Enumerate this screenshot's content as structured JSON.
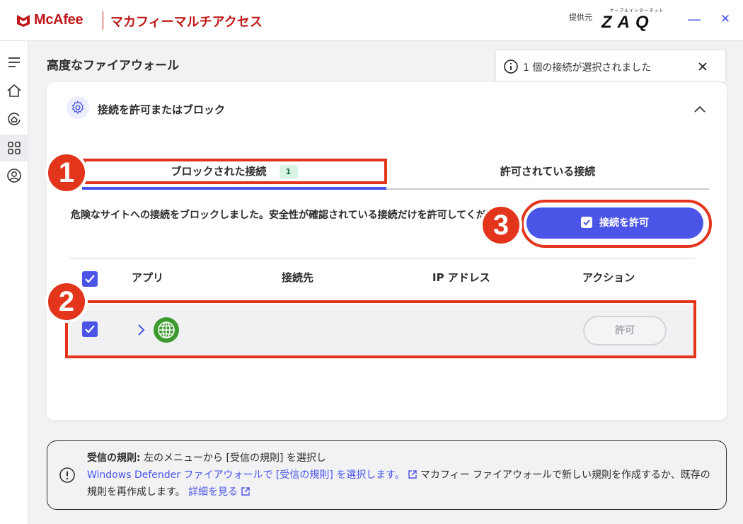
{
  "titlebar": {
    "brand": "McAfee",
    "app_title": "マカフィーマルチアクセス",
    "provider_label": "提供元",
    "provider_logo_small": "ケーブルインターネット",
    "provider_logo": "ZAQ",
    "minimize_glyph": "—",
    "close_glyph": "✕"
  },
  "nav": {
    "items": [
      "menu-icon",
      "home-icon",
      "protection-icon",
      "apps-icon",
      "account-icon"
    ],
    "active_index": 3
  },
  "page": {
    "title": "高度なファイアウォール"
  },
  "toast": {
    "text": "1 個の接続が選択されました"
  },
  "card": {
    "section_title": "接続を許可またはブロック",
    "tabs": {
      "blocked_label": "ブロックされた接続",
      "blocked_count": "1",
      "allowed_label": "許可されている接続"
    },
    "description": "危険なサイトへの接続をブロックしました。安全性が確認されている接続だけを許可してください。",
    "allow_button": "接続を許可",
    "columns": {
      "app": "アプリ",
      "destination": "接続先",
      "ip": "IP アドレス",
      "action": "アクション"
    },
    "row": {
      "action_label": "許可"
    }
  },
  "annotations": {
    "labels": [
      "1",
      "2",
      "3"
    ],
    "color": "#e2351c"
  },
  "info": {
    "bold_lead": "受信の規則:",
    "line1_rest": " 左のメニューから [受信の規則] を選択し",
    "link1": "Windows Defender ファイアウォールで [受信の規則] を選択します。",
    "line2_rest": "マカフィー ファイアウォールで新しい規則を作成するか、既存の規則を再作成します。",
    "link2": "詳細を見る"
  },
  "colors": {
    "accent": "#4a55e8",
    "brand_red": "#c01818",
    "annotation_red": "#e2351c",
    "badge_bg": "#d9f5e6",
    "globe_green": "#3c9a2e"
  }
}
